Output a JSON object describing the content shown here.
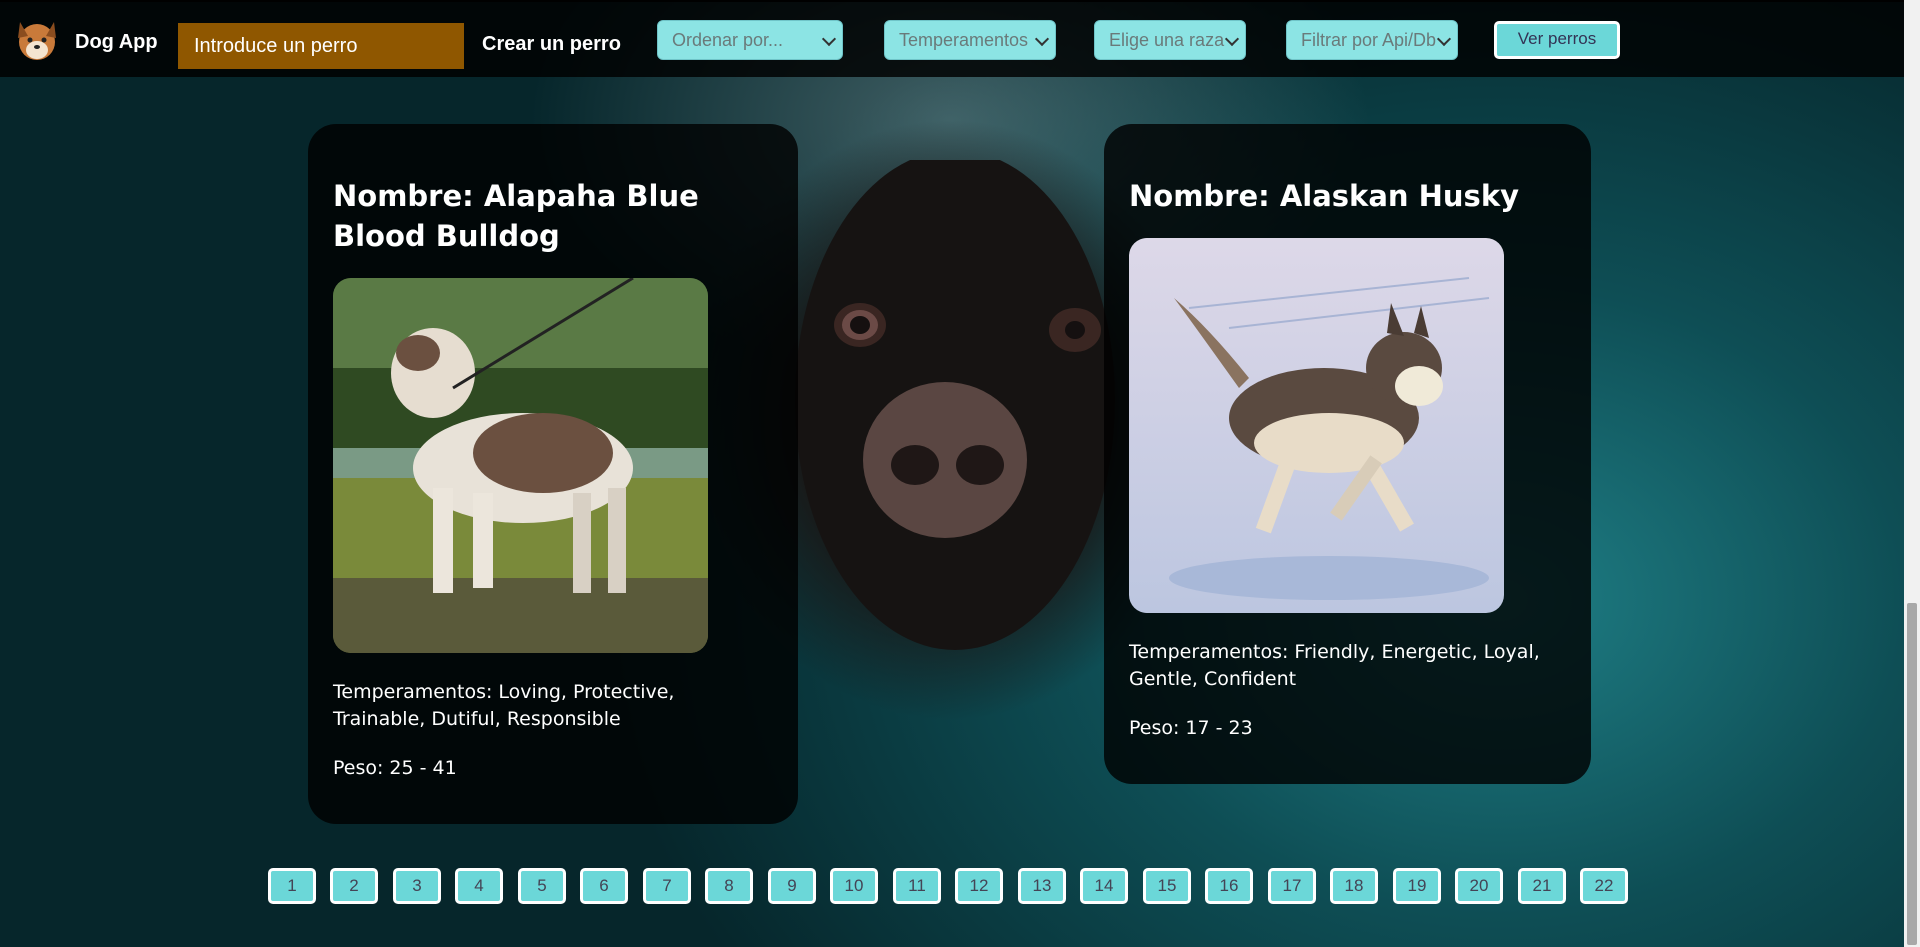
{
  "navbar": {
    "app_title": "Dog App",
    "search_placeholder": "Introduce un perro",
    "create_link": "Crear un perro",
    "selects": [
      {
        "label": "Ordenar por..."
      },
      {
        "label": "Temperamentos"
      },
      {
        "label": "Elige una raza"
      },
      {
        "label": "Filtrar por Api/Db"
      }
    ],
    "view_button": "Ver perros"
  },
  "cards": [
    {
      "title": "Nombre: Alapaha Blue Blood Bulldog",
      "temperaments": "Temperamentos: Loving, Protective, Trainable, Dutiful, Responsible",
      "weight": "Peso: 25 - 41",
      "image_icon": "bulldog-photo"
    },
    {
      "title": "Nombre: Alaskan Husky",
      "temperaments": "Temperamentos: Friendly, Energetic, Loyal, Gentle, Confident",
      "weight": "Peso: 17 - 23",
      "image_icon": "husky-photo"
    }
  ],
  "pagination": [
    "1",
    "2",
    "3",
    "4",
    "5",
    "6",
    "7",
    "8",
    "9",
    "10",
    "11",
    "12",
    "13",
    "14",
    "15",
    "16",
    "17",
    "18",
    "19",
    "20",
    "21",
    "22"
  ],
  "colors": {
    "accent": "#6bd7d8",
    "search_bg": "#8f5700",
    "navbar_bg": "#000000",
    "card_bg": "#000000"
  }
}
